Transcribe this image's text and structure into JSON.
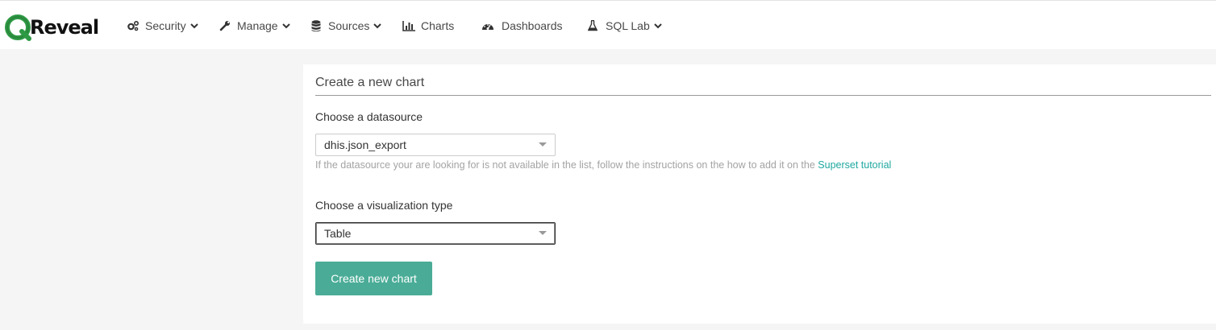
{
  "brand": {
    "name": "Reveal",
    "accent": "#2e9a44"
  },
  "nav": {
    "items": [
      {
        "label": "Security",
        "icon": "cogs-icon",
        "dropdown": true
      },
      {
        "label": "Manage",
        "icon": "wrench-icon",
        "dropdown": true
      },
      {
        "label": "Sources",
        "icon": "database-icon",
        "dropdown": true
      },
      {
        "label": "Charts",
        "icon": "bar-chart-icon",
        "dropdown": false
      },
      {
        "label": "Dashboards",
        "icon": "dashboard-icon",
        "dropdown": false
      },
      {
        "label": "SQL Lab",
        "icon": "flask-icon",
        "dropdown": true
      }
    ]
  },
  "form": {
    "title": "Create a new chart",
    "datasource_label": "Choose a datasource",
    "datasource_value": "dhis.json_export",
    "help_text": "If the datasource your are looking for is not available in the list, follow the instructions on the how to add it on the ",
    "help_link": "Superset tutorial",
    "viz_label": "Choose a visualization type",
    "viz_value": "Table",
    "submit_label": "Create new chart"
  },
  "colors": {
    "primary_button": "#4aac97",
    "link": "#1fa8a0",
    "help_text": "#a3a3a3",
    "content_background": "#f5f5f5"
  }
}
